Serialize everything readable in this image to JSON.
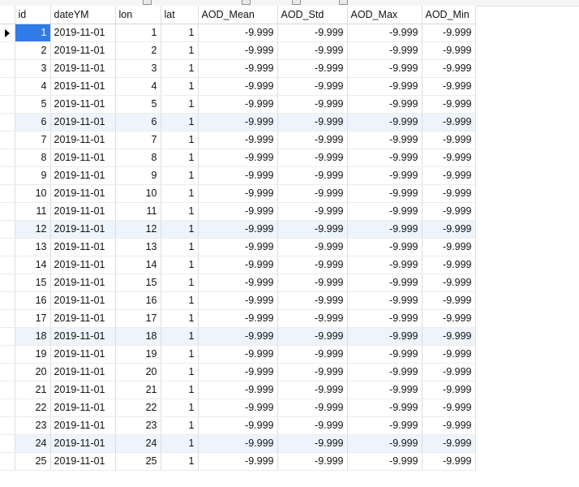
{
  "columns": [
    "id",
    "dateYM",
    "lon",
    "lat",
    "AOD_Mean",
    "AOD_Std",
    "AOD_Max",
    "AOD_Min"
  ],
  "icons": {
    "current_row_indicator": "row-pointer-triangle-icon"
  },
  "colors": {
    "selection": "#2f7be8",
    "alt_row": "#eef4fb"
  },
  "rows": [
    {
      "id": "1",
      "dateYM": "2019-11-01",
      "lon": "1",
      "lat": "1",
      "AOD_Mean": "-9.999",
      "AOD_Std": "-9.999",
      "AOD_Max": "-9.999",
      "AOD_Min": "-9.999"
    },
    {
      "id": "2",
      "dateYM": "2019-11-01",
      "lon": "2",
      "lat": "1",
      "AOD_Mean": "-9.999",
      "AOD_Std": "-9.999",
      "AOD_Max": "-9.999",
      "AOD_Min": "-9.999"
    },
    {
      "id": "3",
      "dateYM": "2019-11-01",
      "lon": "3",
      "lat": "1",
      "AOD_Mean": "-9.999",
      "AOD_Std": "-9.999",
      "AOD_Max": "-9.999",
      "AOD_Min": "-9.999"
    },
    {
      "id": "4",
      "dateYM": "2019-11-01",
      "lon": "4",
      "lat": "1",
      "AOD_Mean": "-9.999",
      "AOD_Std": "-9.999",
      "AOD_Max": "-9.999",
      "AOD_Min": "-9.999"
    },
    {
      "id": "5",
      "dateYM": "2019-11-01",
      "lon": "5",
      "lat": "1",
      "AOD_Mean": "-9.999",
      "AOD_Std": "-9.999",
      "AOD_Max": "-9.999",
      "AOD_Min": "-9.999"
    },
    {
      "id": "6",
      "dateYM": "2019-11-01",
      "lon": "6",
      "lat": "1",
      "AOD_Mean": "-9.999",
      "AOD_Std": "-9.999",
      "AOD_Max": "-9.999",
      "AOD_Min": "-9.999"
    },
    {
      "id": "7",
      "dateYM": "2019-11-01",
      "lon": "7",
      "lat": "1",
      "AOD_Mean": "-9.999",
      "AOD_Std": "-9.999",
      "AOD_Max": "-9.999",
      "AOD_Min": "-9.999"
    },
    {
      "id": "8",
      "dateYM": "2019-11-01",
      "lon": "8",
      "lat": "1",
      "AOD_Mean": "-9.999",
      "AOD_Std": "-9.999",
      "AOD_Max": "-9.999",
      "AOD_Min": "-9.999"
    },
    {
      "id": "9",
      "dateYM": "2019-11-01",
      "lon": "9",
      "lat": "1",
      "AOD_Mean": "-9.999",
      "AOD_Std": "-9.999",
      "AOD_Max": "-9.999",
      "AOD_Min": "-9.999"
    },
    {
      "id": "10",
      "dateYM": "2019-11-01",
      "lon": "10",
      "lat": "1",
      "AOD_Mean": "-9.999",
      "AOD_Std": "-9.999",
      "AOD_Max": "-9.999",
      "AOD_Min": "-9.999"
    },
    {
      "id": "11",
      "dateYM": "2019-11-01",
      "lon": "11",
      "lat": "1",
      "AOD_Mean": "-9.999",
      "AOD_Std": "-9.999",
      "AOD_Max": "-9.999",
      "AOD_Min": "-9.999"
    },
    {
      "id": "12",
      "dateYM": "2019-11-01",
      "lon": "12",
      "lat": "1",
      "AOD_Mean": "-9.999",
      "AOD_Std": "-9.999",
      "AOD_Max": "-9.999",
      "AOD_Min": "-9.999"
    },
    {
      "id": "13",
      "dateYM": "2019-11-01",
      "lon": "13",
      "lat": "1",
      "AOD_Mean": "-9.999",
      "AOD_Std": "-9.999",
      "AOD_Max": "-9.999",
      "AOD_Min": "-9.999"
    },
    {
      "id": "14",
      "dateYM": "2019-11-01",
      "lon": "14",
      "lat": "1",
      "AOD_Mean": "-9.999",
      "AOD_Std": "-9.999",
      "AOD_Max": "-9.999",
      "AOD_Min": "-9.999"
    },
    {
      "id": "15",
      "dateYM": "2019-11-01",
      "lon": "15",
      "lat": "1",
      "AOD_Mean": "-9.999",
      "AOD_Std": "-9.999",
      "AOD_Max": "-9.999",
      "AOD_Min": "-9.999"
    },
    {
      "id": "16",
      "dateYM": "2019-11-01",
      "lon": "16",
      "lat": "1",
      "AOD_Mean": "-9.999",
      "AOD_Std": "-9.999",
      "AOD_Max": "-9.999",
      "AOD_Min": "-9.999"
    },
    {
      "id": "17",
      "dateYM": "2019-11-01",
      "lon": "17",
      "lat": "1",
      "AOD_Mean": "-9.999",
      "AOD_Std": "-9.999",
      "AOD_Max": "-9.999",
      "AOD_Min": "-9.999"
    },
    {
      "id": "18",
      "dateYM": "2019-11-01",
      "lon": "18",
      "lat": "1",
      "AOD_Mean": "-9.999",
      "AOD_Std": "-9.999",
      "AOD_Max": "-9.999",
      "AOD_Min": "-9.999"
    },
    {
      "id": "19",
      "dateYM": "2019-11-01",
      "lon": "19",
      "lat": "1",
      "AOD_Mean": "-9.999",
      "AOD_Std": "-9.999",
      "AOD_Max": "-9.999",
      "AOD_Min": "-9.999"
    },
    {
      "id": "20",
      "dateYM": "2019-11-01",
      "lon": "20",
      "lat": "1",
      "AOD_Mean": "-9.999",
      "AOD_Std": "-9.999",
      "AOD_Max": "-9.999",
      "AOD_Min": "-9.999"
    },
    {
      "id": "21",
      "dateYM": "2019-11-01",
      "lon": "21",
      "lat": "1",
      "AOD_Mean": "-9.999",
      "AOD_Std": "-9.999",
      "AOD_Max": "-9.999",
      "AOD_Min": "-9.999"
    },
    {
      "id": "22",
      "dateYM": "2019-11-01",
      "lon": "22",
      "lat": "1",
      "AOD_Mean": "-9.999",
      "AOD_Std": "-9.999",
      "AOD_Max": "-9.999",
      "AOD_Min": "-9.999"
    },
    {
      "id": "23",
      "dateYM": "2019-11-01",
      "lon": "23",
      "lat": "1",
      "AOD_Mean": "-9.999",
      "AOD_Std": "-9.999",
      "AOD_Max": "-9.999",
      "AOD_Min": "-9.999"
    },
    {
      "id": "24",
      "dateYM": "2019-11-01",
      "lon": "24",
      "lat": "1",
      "AOD_Mean": "-9.999",
      "AOD_Std": "-9.999",
      "AOD_Max": "-9.999",
      "AOD_Min": "-9.999"
    },
    {
      "id": "25",
      "dateYM": "2019-11-01",
      "lon": "25",
      "lat": "1",
      "AOD_Mean": "-9.999",
      "AOD_Std": "-9.999",
      "AOD_Max": "-9.999",
      "AOD_Min": "-9.999"
    }
  ],
  "current_row": 1,
  "selected_cell": {
    "row": 1,
    "column": "id"
  }
}
